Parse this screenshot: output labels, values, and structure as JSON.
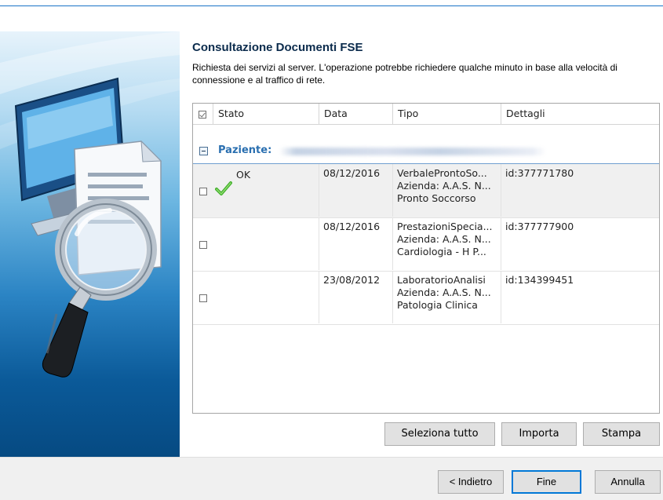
{
  "dialog": {
    "title": "Consultazione Documenti FSE",
    "subtitle": "Richiesta dei servizi al server. L'operazione potrebbe richiedere qualche minuto in base alla velocità di connessione e al traffico di rete."
  },
  "grid": {
    "columns": [
      "Stato",
      "Data",
      "Tipo",
      "Dettagli"
    ],
    "group_label": "Paziente:",
    "rows": [
      {
        "checked": false,
        "status": "OK",
        "data": "08/12/2016",
        "tipo": [
          "VerbaleProntoSo...",
          "Azienda: A.A.S. N...",
          "Pronto Soccorso"
        ],
        "dettagli": "id:377771780"
      },
      {
        "checked": false,
        "status": "",
        "data": "08/12/2016",
        "tipo": [
          "PrestazioniSpecia...",
          "Azienda: A.A.S. N...",
          "Cardiologia - H P..."
        ],
        "dettagli": "id:377777900"
      },
      {
        "checked": false,
        "status": "",
        "data": "23/08/2012",
        "tipo": [
          "LaboratorioAnalisi",
          "Azienda: A.A.S. N...",
          "Patologia Clinica"
        ],
        "dettagli": "id:134399451"
      }
    ]
  },
  "actions": {
    "select_all": "Seleziona tutto",
    "import": "Importa",
    "print": "Stampa"
  },
  "wizard": {
    "back": "< Indietro",
    "finish": "Fine",
    "cancel": "Annulla"
  },
  "colors": {
    "accent": "#0078d7",
    "group_text": "#2a6fb0",
    "ok_check": "#3fae2a"
  }
}
